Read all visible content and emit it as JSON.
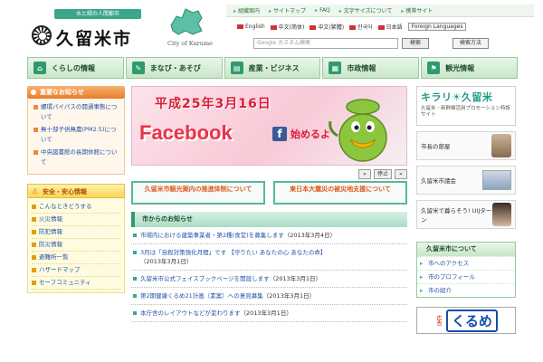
{
  "header": {
    "tagline": "水と緑の人間都市",
    "city_name": "久留米市",
    "city_en": "City of Kurume",
    "topnav": [
      "組織案内",
      "サイトマップ",
      "FAQ",
      "文字サイズについて",
      "携帯サイト"
    ],
    "languages": [
      "English",
      "中文(简体)",
      "中文(繁體)",
      "한국어",
      "日本語"
    ],
    "foreign_btn": "Foreign Languages",
    "search_placeholder": "Google カスタム検索",
    "search_btn": "検索",
    "detail_btn": "検索方法"
  },
  "nav": [
    {
      "label": "くらしの情報",
      "icon": "⌂"
    },
    {
      "label": "まなび・あそび",
      "icon": "✎"
    },
    {
      "label": "産業・ビジネス",
      "icon": "▤"
    },
    {
      "label": "市政情報",
      "icon": "▦"
    },
    {
      "label": "観光情報",
      "icon": "⚑"
    }
  ],
  "left": {
    "notice_title": "重要なお知らせ",
    "notices": [
      "螺環バイパスの開通事態について",
      "無十部子供無農(PM2.5)について",
      "中央図書館の長期休館について"
    ],
    "safety_title": "安全・安心情報",
    "safety_items": [
      "こんなときどうする",
      "火災情報",
      "防犯情報",
      "防災情報",
      "避難所一覧",
      "ハザードマップ",
      "セーフコミュニティ"
    ]
  },
  "banner": {
    "title": "平成25年3月16日",
    "fb": "Facebook",
    "fb_icon": "f",
    "sub": "始めるよ",
    "prev": "«",
    "stop": "停止",
    "next": "»"
  },
  "sub_banners": [
    "久留米市観光案内の推進体制について",
    "東日本大震災の被災地支援について"
  ],
  "news": {
    "title": "市からのお知らせ",
    "items": [
      {
        "text": "市場内における建築事業者・第2種(食堂)を募集します",
        "date": "（2013年3月4日）"
      },
      {
        "text": "3月は「自殺対策強化月間」です 【守りたい あなたの心 あなたの命】",
        "date": "（2013年3月1日）"
      },
      {
        "text": "久留米市公式フェイスブックページを開設します",
        "date": "（2013年3月1日）"
      },
      {
        "text": "第2期健康くるめ21計画（素案）への意見募集",
        "date": "（2013年3月1日）"
      },
      {
        "text": "本庁舎のレイアウトなどが変わります",
        "date": "（2013年3月1日）"
      }
    ]
  },
  "right": {
    "promo_title": "キラリ☀久留米",
    "promo_sub": "久留米・新幹線活用プロモーション特設サイト",
    "links": [
      "市長の部屋",
      "久留米市議会",
      "久留米で暮らそう! UIJターン"
    ],
    "about_title": "久留米市について",
    "about_items": [
      "市へのアクセス",
      "市のプロフィール",
      "市の紹介"
    ],
    "ad_small": "広告",
    "ad_big": "くるめ"
  }
}
